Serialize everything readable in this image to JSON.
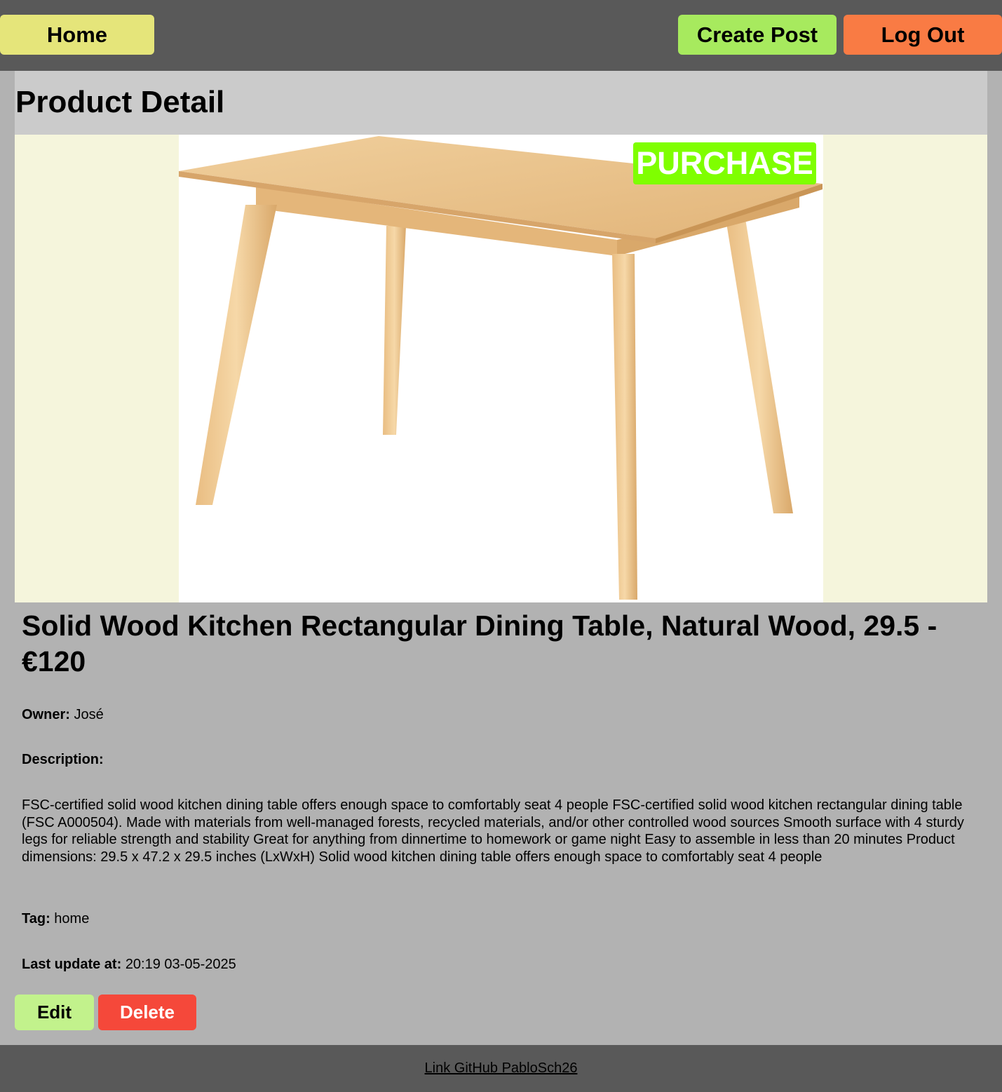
{
  "nav": {
    "home_label": "Home",
    "create_post_label": "Create Post",
    "logout_label": "Log Out"
  },
  "page": {
    "title": "Product Detail"
  },
  "product": {
    "purchase_label": "PURCHASE",
    "name_price": "Solid Wood Kitchen Rectangular Dining Table, Natural Wood, 29.5 - €120",
    "owner_label": "Owner:",
    "owner_value": "José",
    "description_label": "Description:",
    "description": "FSC-certified solid wood kitchen dining table offers enough space to comfortably seat 4 people FSC-certified solid wood kitchen rectangular dining table (FSC A000504). Made with materials from well-managed forests, recycled materials, and/or other controlled wood sources Smooth surface with 4 sturdy legs for reliable strength and stability Great for anything from dinnertime to homework or game night Easy to assemble in less than 20 minutes Product dimensions: 29.5 x 47.2 x 29.5 inches (LxWxH) Solid wood kitchen dining table offers enough space to comfortably seat 4 people",
    "tag_label": "Tag:",
    "tag_value": "home",
    "update_label": "Last update at:",
    "update_value": "20:19 03-05-2025",
    "image_icon": "wooden-dining-table-photo"
  },
  "actions": {
    "edit_label": "Edit",
    "delete_label": "Delete"
  },
  "footer": {
    "link_text": "Link GitHub PabloSch26"
  },
  "colors": {
    "topbar": "#595959",
    "home_button": "#e5e57a",
    "create_button": "#a7ea5e",
    "logout_button": "#f97b44",
    "purchase_button": "#7fff00",
    "edit_button": "#c2f28c",
    "delete_button": "#f5483a",
    "image_background": "#f5f5dc"
  }
}
